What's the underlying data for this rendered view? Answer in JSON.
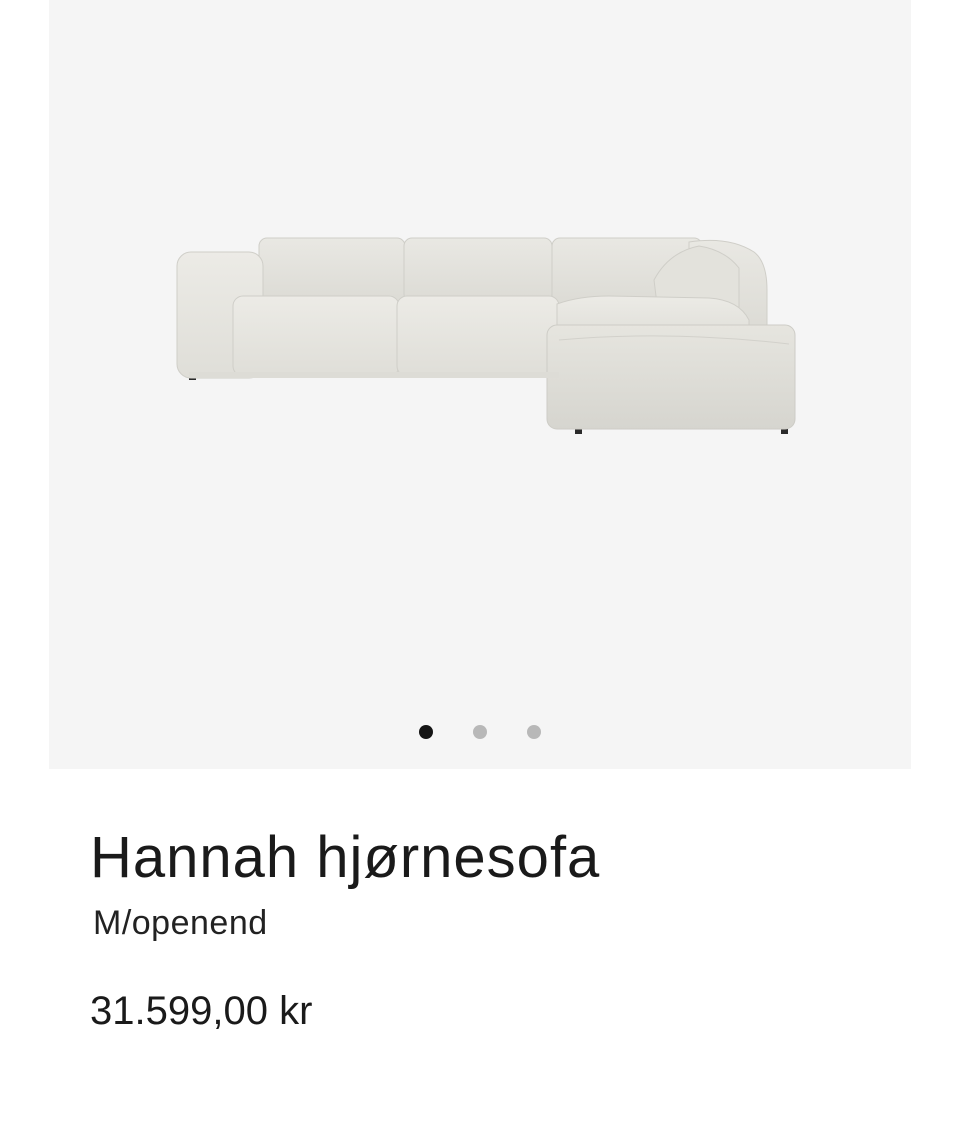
{
  "gallery": {
    "image_alt": "Hannah hjørnesofa",
    "image_subject": "sofa-image",
    "slides_count": 3,
    "active_slide": 1,
    "background_color": "#f5f5f5"
  },
  "product": {
    "title": "Hannah hjørnesofa",
    "variant": "M/openend",
    "price": "31.599,00 kr"
  }
}
